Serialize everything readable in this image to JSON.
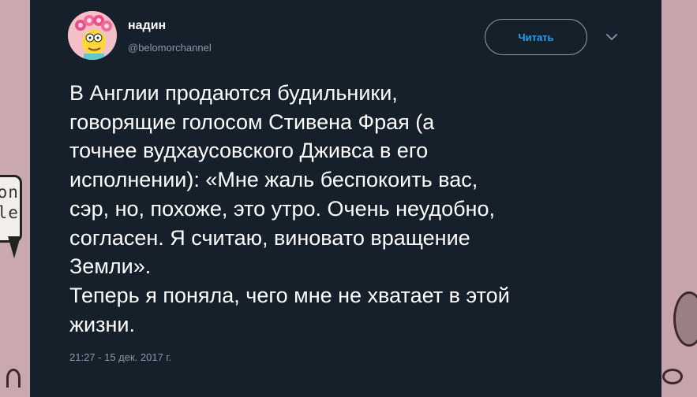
{
  "tweet": {
    "author": {
      "name": "надин",
      "handle": "@belomorchannel"
    },
    "follow_label": "Читать",
    "text": "В Англии продаются будильники,\nговорящие голосом Стивена Фрая (а\nточнее вудхаусовского Дживса в его\nисполнении): «Мне жаль беспокоить вас,\nсэр, но, похоже, это утро. Очень неудобно,\nсогласен. Я считаю, виновато вращение\nЗемли».\nТеперь я поняла, чего мне не хватает в этой\nжизни.",
    "timestamp": "21:27 - 15 дек. 2017 г."
  },
  "background": {
    "bubble_text": "gon\nble"
  },
  "icons": {
    "chevron": "chevron-down-icon",
    "avatar": "cartoon-avatar"
  },
  "colors": {
    "card_background": "#15202b",
    "text_primary": "#ffffff",
    "text_secondary": "#8899a6",
    "accent": "#1da1f2",
    "wallpaper": "#c9a9b0"
  }
}
